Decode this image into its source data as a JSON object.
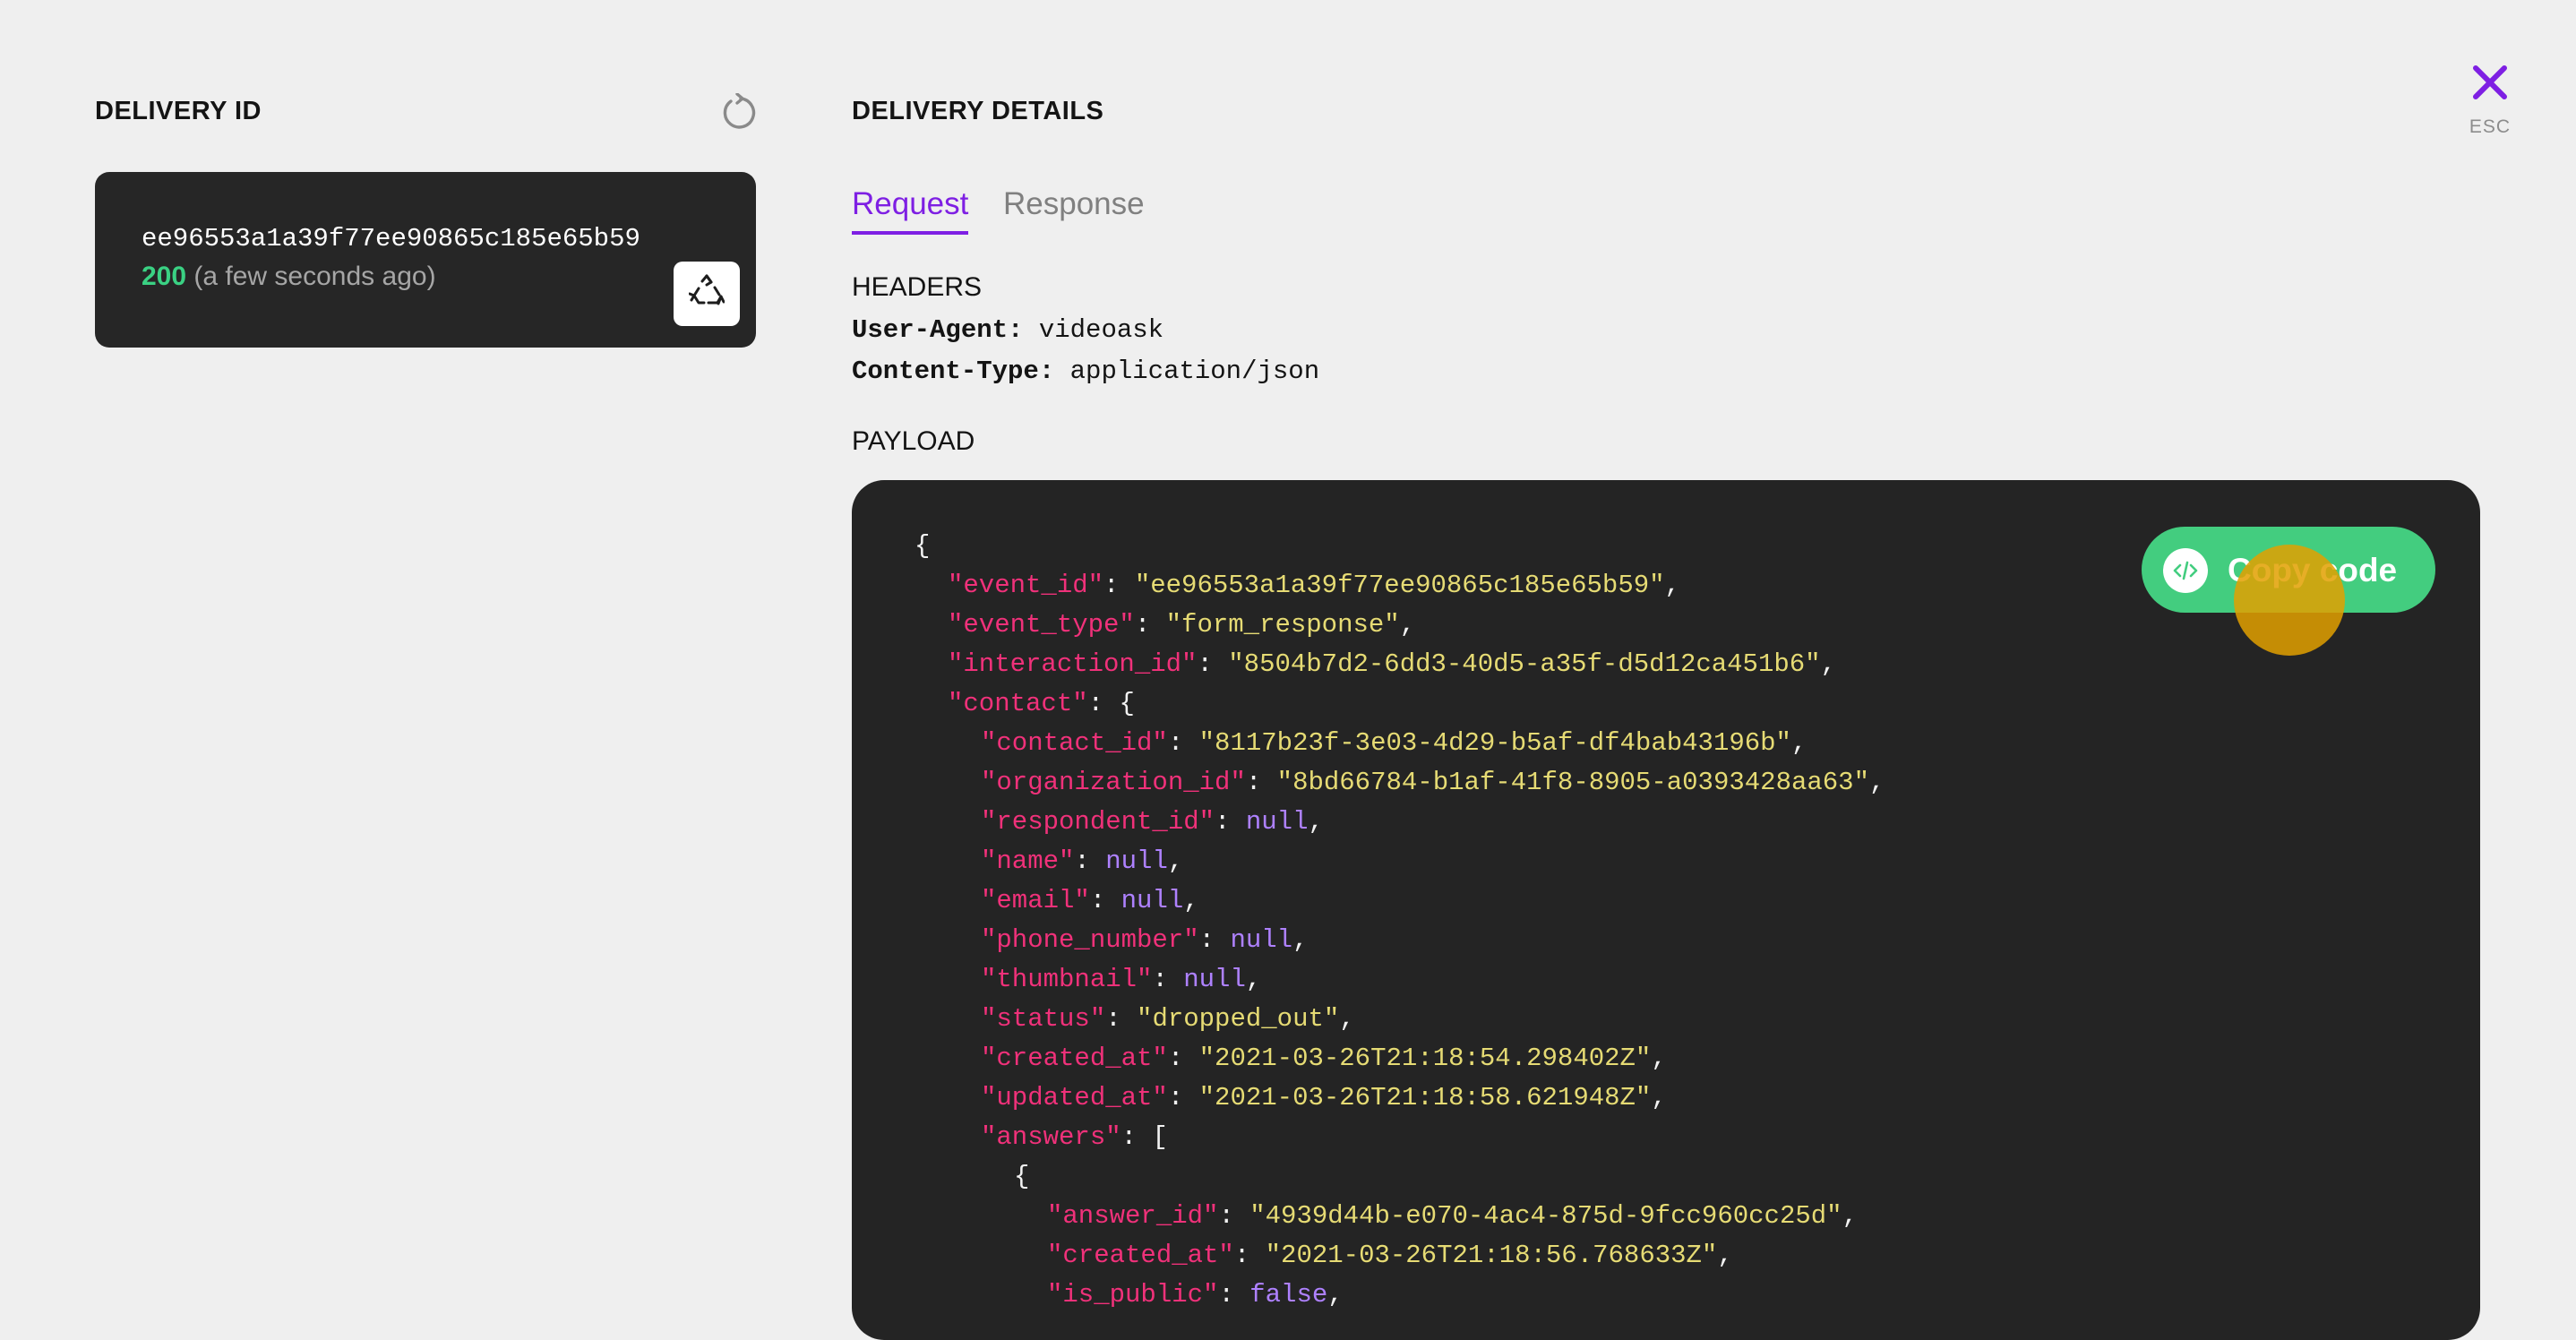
{
  "left_panel": {
    "title": "DELIVERY ID",
    "refresh_icon": "refresh-icon",
    "delivery": {
      "id": "ee96553a1a39f77ee90865c185e65b59",
      "status_code": "200",
      "status_time": "(a few seconds ago)",
      "redeliver_icon": "recycle-icon"
    }
  },
  "right_panel": {
    "title": "DELIVERY DETAILS",
    "close_icon": "close-icon",
    "esc_label": "ESC",
    "tabs": [
      {
        "label": "Request",
        "active": true
      },
      {
        "label": "Response",
        "active": false
      }
    ],
    "headers_label": "HEADERS",
    "headers": [
      {
        "key": "User-Agent:",
        "value": "videoask"
      },
      {
        "key": "Content-Type:",
        "value": "application/json"
      }
    ],
    "payload_label": "PAYLOAD",
    "copy_button_label": "Copy code",
    "copy_icon": "code-icon"
  },
  "payload_lines": [
    {
      "indent": 0,
      "parts": [
        {
          "t": "p",
          "v": "{"
        }
      ]
    },
    {
      "indent": 1,
      "parts": [
        {
          "t": "k",
          "v": "\"event_id\""
        },
        {
          "t": "p",
          "v": ": "
        },
        {
          "t": "s",
          "v": "\"ee96553a1a39f77ee90865c185e65b59\""
        },
        {
          "t": "p",
          "v": ","
        }
      ]
    },
    {
      "indent": 1,
      "parts": [
        {
          "t": "k",
          "v": "\"event_type\""
        },
        {
          "t": "p",
          "v": ": "
        },
        {
          "t": "s",
          "v": "\"form_response\""
        },
        {
          "t": "p",
          "v": ","
        }
      ]
    },
    {
      "indent": 1,
      "parts": [
        {
          "t": "k",
          "v": "\"interaction_id\""
        },
        {
          "t": "p",
          "v": ": "
        },
        {
          "t": "s",
          "v": "\"8504b7d2-6dd3-40d5-a35f-d5d12ca451b6\""
        },
        {
          "t": "p",
          "v": ","
        }
      ]
    },
    {
      "indent": 1,
      "parts": [
        {
          "t": "k",
          "v": "\"contact\""
        },
        {
          "t": "p",
          "v": ": {"
        }
      ]
    },
    {
      "indent": 2,
      "parts": [
        {
          "t": "k",
          "v": "\"contact_id\""
        },
        {
          "t": "p",
          "v": ": "
        },
        {
          "t": "s",
          "v": "\"8117b23f-3e03-4d29-b5af-df4bab43196b\""
        },
        {
          "t": "p",
          "v": ","
        }
      ]
    },
    {
      "indent": 2,
      "parts": [
        {
          "t": "k",
          "v": "\"organization_id\""
        },
        {
          "t": "p",
          "v": ": "
        },
        {
          "t": "s",
          "v": "\"8bd66784-b1af-41f8-8905-a0393428aa63\""
        },
        {
          "t": "p",
          "v": ","
        }
      ]
    },
    {
      "indent": 2,
      "parts": [
        {
          "t": "k",
          "v": "\"respondent_id\""
        },
        {
          "t": "p",
          "v": ": "
        },
        {
          "t": "n",
          "v": "null"
        },
        {
          "t": "p",
          "v": ","
        }
      ]
    },
    {
      "indent": 2,
      "parts": [
        {
          "t": "k",
          "v": "\"name\""
        },
        {
          "t": "p",
          "v": ": "
        },
        {
          "t": "n",
          "v": "null"
        },
        {
          "t": "p",
          "v": ","
        }
      ]
    },
    {
      "indent": 2,
      "parts": [
        {
          "t": "k",
          "v": "\"email\""
        },
        {
          "t": "p",
          "v": ": "
        },
        {
          "t": "n",
          "v": "null"
        },
        {
          "t": "p",
          "v": ","
        }
      ]
    },
    {
      "indent": 2,
      "parts": [
        {
          "t": "k",
          "v": "\"phone_number\""
        },
        {
          "t": "p",
          "v": ": "
        },
        {
          "t": "n",
          "v": "null"
        },
        {
          "t": "p",
          "v": ","
        }
      ]
    },
    {
      "indent": 2,
      "parts": [
        {
          "t": "k",
          "v": "\"thumbnail\""
        },
        {
          "t": "p",
          "v": ": "
        },
        {
          "t": "n",
          "v": "null"
        },
        {
          "t": "p",
          "v": ","
        }
      ]
    },
    {
      "indent": 2,
      "parts": [
        {
          "t": "k",
          "v": "\"status\""
        },
        {
          "t": "p",
          "v": ": "
        },
        {
          "t": "s",
          "v": "\"dropped_out\""
        },
        {
          "t": "p",
          "v": ","
        }
      ]
    },
    {
      "indent": 2,
      "parts": [
        {
          "t": "k",
          "v": "\"created_at\""
        },
        {
          "t": "p",
          "v": ": "
        },
        {
          "t": "s",
          "v": "\"2021-03-26T21:18:54.298402Z\""
        },
        {
          "t": "p",
          "v": ","
        }
      ]
    },
    {
      "indent": 2,
      "parts": [
        {
          "t": "k",
          "v": "\"updated_at\""
        },
        {
          "t": "p",
          "v": ": "
        },
        {
          "t": "s",
          "v": "\"2021-03-26T21:18:58.621948Z\""
        },
        {
          "t": "p",
          "v": ","
        }
      ]
    },
    {
      "indent": 2,
      "parts": [
        {
          "t": "k",
          "v": "\"answers\""
        },
        {
          "t": "p",
          "v": ": ["
        }
      ]
    },
    {
      "indent": 3,
      "parts": [
        {
          "t": "p",
          "v": "{"
        }
      ]
    },
    {
      "indent": 4,
      "parts": [
        {
          "t": "k",
          "v": "\"answer_id\""
        },
        {
          "t": "p",
          "v": ": "
        },
        {
          "t": "s",
          "v": "\"4939d44b-e070-4ac4-875d-9fcc960cc25d\""
        },
        {
          "t": "p",
          "v": ","
        }
      ]
    },
    {
      "indent": 4,
      "parts": [
        {
          "t": "k",
          "v": "\"created_at\""
        },
        {
          "t": "p",
          "v": ": "
        },
        {
          "t": "s",
          "v": "\"2021-03-26T21:18:56.768633Z\""
        },
        {
          "t": "p",
          "v": ","
        }
      ]
    },
    {
      "indent": 4,
      "parts": [
        {
          "t": "k",
          "v": "\"is_public\""
        },
        {
          "t": "p",
          "v": ": "
        },
        {
          "t": "n",
          "v": "false"
        },
        {
          "t": "p",
          "v": ","
        }
      ]
    }
  ],
  "colors": {
    "accent": "#7e1fe3",
    "success": "#3ad183",
    "copy_button": "#43cd7f",
    "code_background": "#242424",
    "json_key": "#f0317a",
    "json_string": "#e6db74",
    "json_null": "#ae81ff"
  }
}
